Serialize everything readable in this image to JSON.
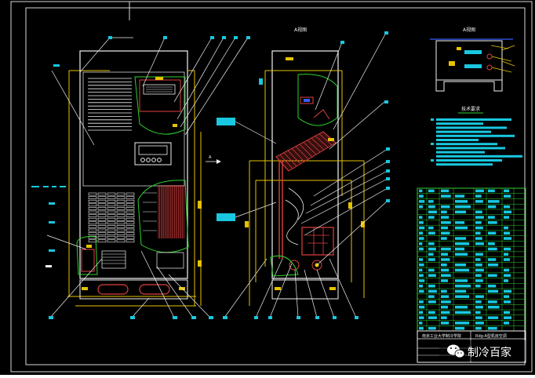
{
  "colors": {
    "background": "#000000",
    "frame": "#e6e6e6",
    "outline": "#f2f2f2",
    "yellow": "#e6c200",
    "green": "#2fd02f",
    "red": "#e04040",
    "cyan": "#19c8e0",
    "blue": "#3a5cff",
    "magenta": "#d040d0"
  },
  "drawing": {
    "front_view_label": "",
    "side_view_label": "A视图",
    "detail_view_label": "A视图",
    "arrow_label": "A"
  },
  "notes": {
    "title": "技术要求"
  },
  "title_block": {
    "left_cell": "南京工业大学制冷学院",
    "right_cell": "Rdg-A型机房空调"
  },
  "watermark": {
    "text": "制冷百家",
    "icon": "wechat-icon"
  }
}
